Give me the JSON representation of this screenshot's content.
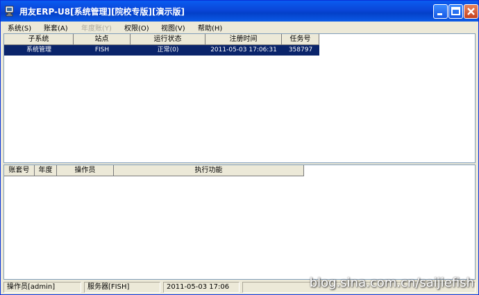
{
  "window": {
    "title": "用友ERP-U8[系统管理][院校专版][演示版]",
    "buttons": {
      "minimize": "minimize",
      "maximize": "maximize",
      "close": "close"
    }
  },
  "menu": {
    "items": [
      {
        "label": "系统(S)",
        "enabled": true
      },
      {
        "label": "账套(A)",
        "enabled": true
      },
      {
        "label": "年度账(Y)",
        "enabled": false
      },
      {
        "label": "权限(O)",
        "enabled": true
      },
      {
        "label": "视图(V)",
        "enabled": true
      },
      {
        "label": "帮助(H)",
        "enabled": true
      }
    ]
  },
  "subsystems": {
    "columns": [
      "子系统",
      "站点",
      "运行状态",
      "注册时间",
      "任务号"
    ],
    "rows": [
      [
        "系统管理",
        "FISH",
        "正常(0)",
        "2011-05-03 17:06:31",
        "358797"
      ]
    ]
  },
  "operations": {
    "columns": [
      "账套号",
      "年度",
      "操作员",
      "执行功能"
    ],
    "rows": []
  },
  "statusbar": {
    "operator": "操作员[admin]",
    "server": "服务器[FISH]",
    "datetime": "2011-05-03 17:06"
  },
  "watermark": "blog.sina.com.cn/saijiefish",
  "colors": {
    "titlebar": "#0a46d8",
    "selection": "#0a246a",
    "face": "#ece9d8"
  }
}
